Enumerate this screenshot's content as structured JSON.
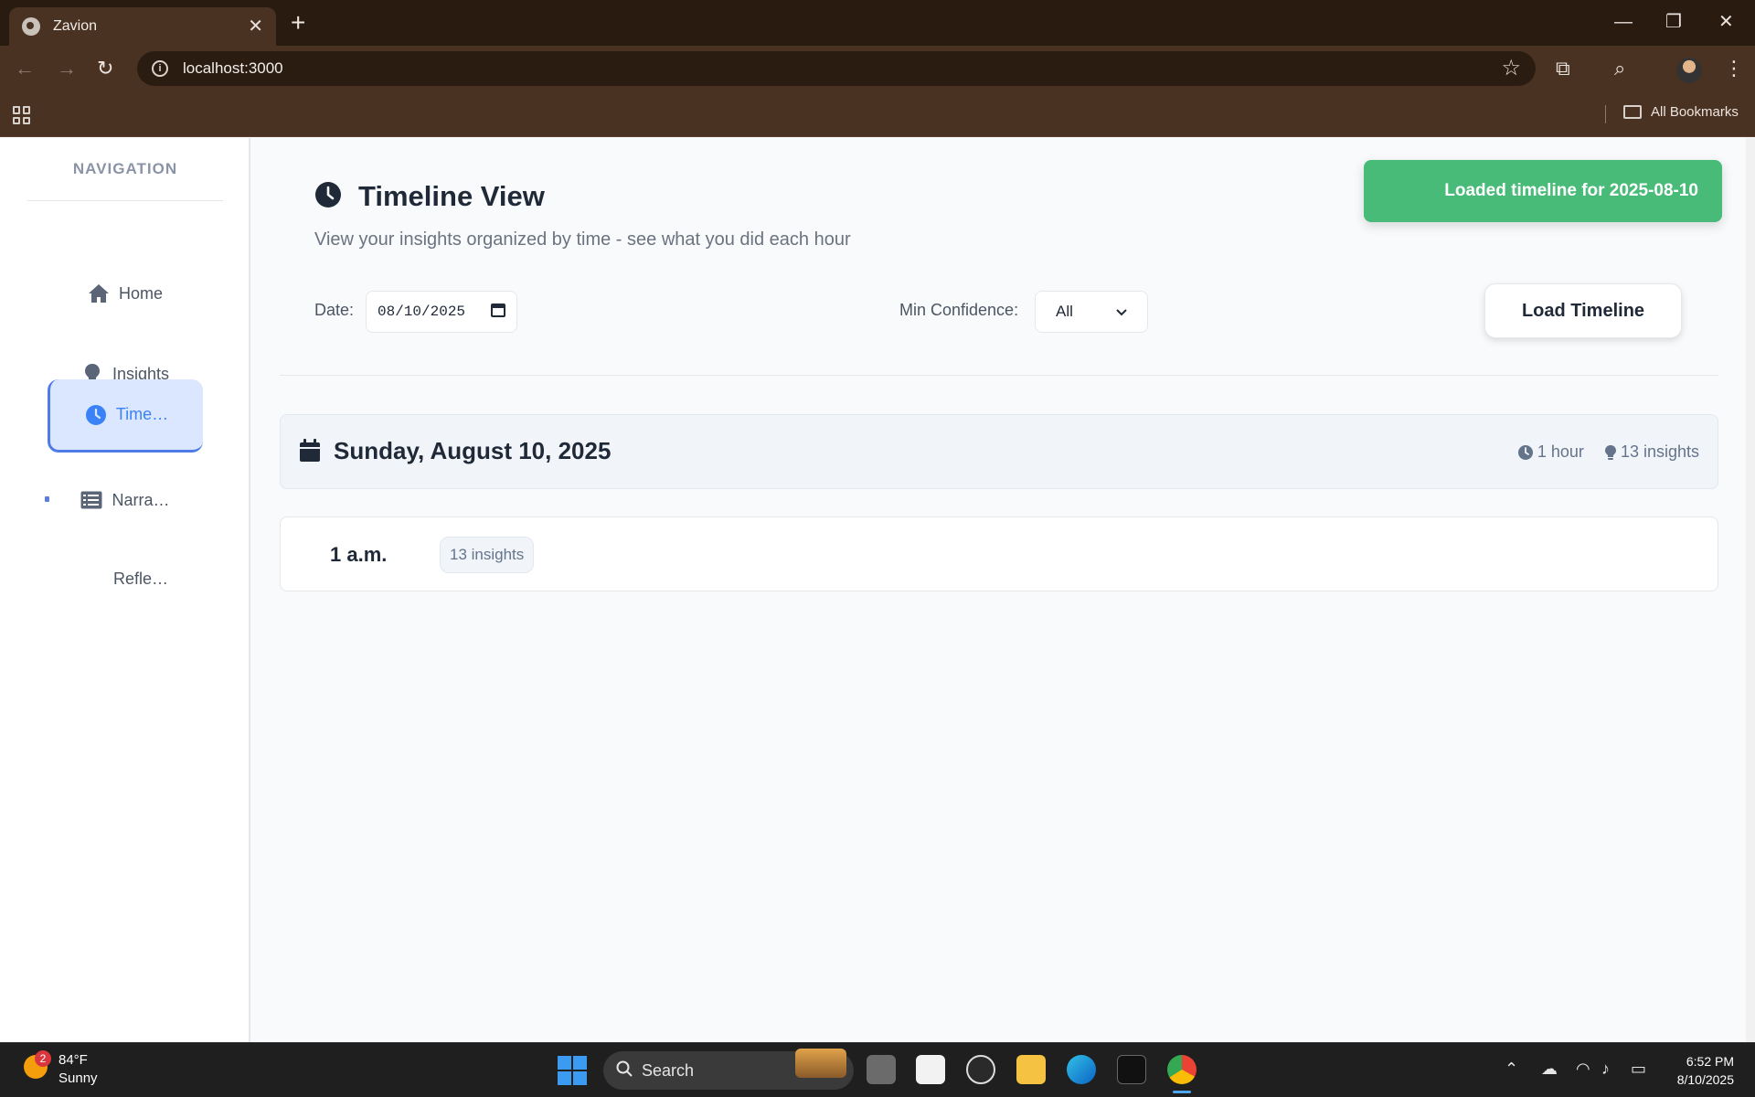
{
  "browser": {
    "tab_title": "Zavion",
    "tab_close": "✕",
    "new_tab": "+",
    "url": "localhost:3000",
    "bookmarks_label": "All Bookmarks",
    "window_minimize": "—",
    "window_restore": "❐",
    "window_close": "✕"
  },
  "sidebar": {
    "heading": "NAVIGATION",
    "items": [
      {
        "label": "Home",
        "icon": "home-icon"
      },
      {
        "label": "Insights",
        "icon": "lightbulb-icon"
      },
      {
        "label": "Time…",
        "icon": "clock-icon",
        "active": true
      },
      {
        "label": "Narra…",
        "icon": "list-icon"
      },
      {
        "label": "Refle…",
        "icon": "none"
      }
    ]
  },
  "header": {
    "title": "Timeline View",
    "subtitle": "View your insights organized by time - see what you did each hour",
    "date_label": "Date:",
    "date_value": "08/10/2025",
    "confidence_label": "Min Confidence:",
    "confidence_value": "All",
    "load_button": "Load Timeline"
  },
  "toast": {
    "message": "Loaded timeline for 2025-08-10",
    "color": "#48bb78"
  },
  "day": {
    "title": "Sunday, August 10, 2025",
    "hours_stat": "1 hour",
    "insights_stat": "13 insights"
  },
  "hours": [
    {
      "label": "1 a.m.",
      "badge": "13 insights"
    }
  ],
  "taskbar": {
    "weather_badge": "2",
    "temperature": "84°F",
    "condition": "Sunny",
    "search_label": "Search",
    "time": "6:52 PM",
    "date": "8/10/2025"
  },
  "colors": {
    "accent": "#3b82f6",
    "active_bg": "#dbe7ff",
    "success": "#48bb78",
    "browser_frame": "#4a3222"
  }
}
